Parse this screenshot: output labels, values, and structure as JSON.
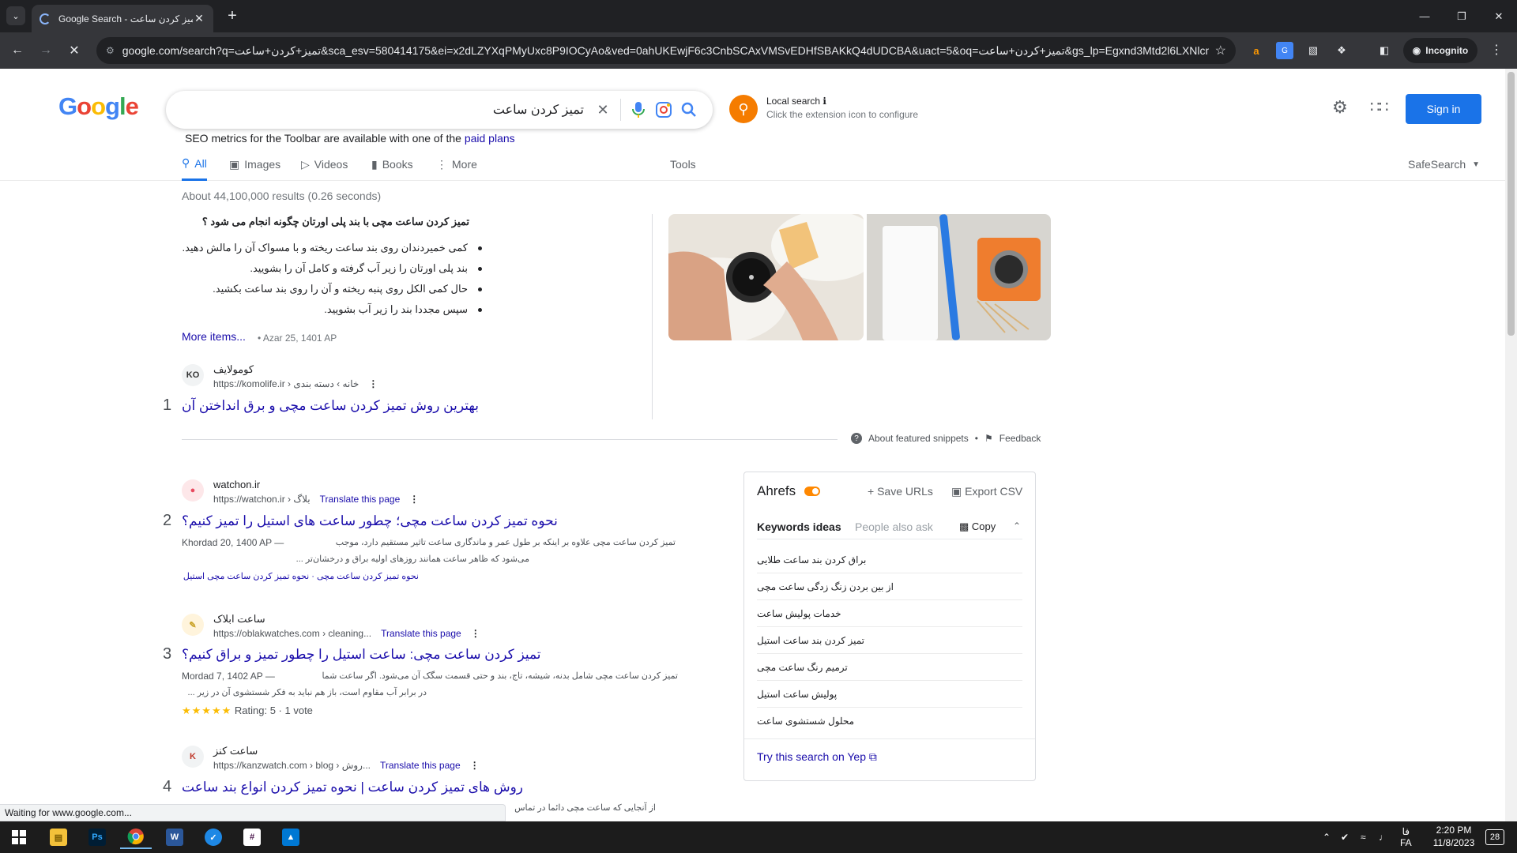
{
  "browser": {
    "tab_title": "Google Search - تمیز کردن ساعت",
    "tab_close": "✕",
    "new_tab": "+",
    "url": "google.com/search?q=تمیز+کردن+ساعت&sca_esv=580414175&ei=x2dLZYXqPMyUxc8P9IOCyAo&ved=0ahUKEwjF6c3CnbSCAxVMSvEDHfSBAKkQ4dUDCBA&uact=5&oq=تمیز+کردن+ساعت&gs_lp=Egxnd3Mtd2l6LXNlcnAi...",
    "incognito_label": "Incognito",
    "status_text": "Waiting for www.google.com..."
  },
  "google": {
    "logo": [
      "G",
      "o",
      "o",
      "g",
      "l",
      "e"
    ],
    "logo_colors": [
      "#4285f4",
      "#ea4335",
      "#fbbc05",
      "#4285f4",
      "#34a853",
      "#ea4335"
    ],
    "query": "تمیز کردن ساعت",
    "signin_label": "Sign in",
    "local_search_title": "Local search ℹ",
    "local_search_sub": "Click the extension icon to configure",
    "seo_note": "SEO metrics for the Toolbar are available with one of the",
    "seo_link": "paid plans",
    "tabs": {
      "all": "All",
      "images": "Images",
      "videos": "Videos",
      "books": "Books",
      "more": "More",
      "tools": "Tools"
    },
    "safesearch": "SafeSearch",
    "stats": "About 44,100,000 results (0.26 seconds)"
  },
  "snippet": {
    "question": "تمیز کردن ساعت مچی با بند پلی اورتان چگونه انجام می شود ؟",
    "items": [
      "کمی خمیردندان روی بند ساعت ریخته و با مسواک آن را مالش دهید.",
      "بند پلی اورتان را زیر آب گرفته و کامل آن را بشویید.",
      "حال کمی الکل روی پنبه ریخته و آن را روی بند ساعت بکشید.",
      "سپس مجددا بند را زیر آب بشویید."
    ],
    "more_items": "More items...",
    "date": "• Azar 25, 1401 AP",
    "source_name": "کومولایف",
    "source_url": "https://komolife.ir › خانه › دسته بندی",
    "source_fav": "KO",
    "title": "بهترین روش تمیز کردن ساعت مچی و برق انداختن آن",
    "num": "1",
    "about": "About featured snippets",
    "sep": "•",
    "feedback": "Feedback"
  },
  "results": [
    {
      "num": "2",
      "site": "watchon.ir",
      "url": "https://watchon.ir › بلاگ",
      "translate": "Translate this page",
      "title": "نحوه تمیز کردن ساعت مچی؛ چطور ساعت های استیل را تمیز کنیم؟",
      "meta": "Khordad 20, 1400 AP —",
      "line1": "تمیز کردن ساعت مچی علاوه بر اینکه بر طول عمر و ماندگاری ساعت تاثیر مستقیم دارد، موجب",
      "line2": "می‌شود که ظاهر ساعت همانند روزهای اولیه براق و درخشان‌تر ...",
      "sitelinks": "نحوه تمیز کردن ساعت مچی · نحوه تمیز کردن ساعت مچی استیل"
    },
    {
      "num": "3",
      "site": "ساعت ابلاک",
      "url": "https://oblakwatches.com › cleaning...",
      "translate": "Translate this page",
      "title": "تمیز کردن ساعت مچی: ساعت استیل را چطور تمیز و براق کنیم؟",
      "meta": "Mordad 7, 1402 AP —",
      "line1": "تمیز کردن ساعت مچی شامل بدنه، شیشه، تاج، بند و حتی قسمت سگک آن می‌شود. اگر ساعت شما",
      "line2": "در برابر آب مقاوم است، باز هم نباید به فکر شستشوی آن در زیر ...",
      "stars": "★★★★★",
      "rating": "Rating: 5 · 1 vote"
    },
    {
      "num": "4",
      "site": "ساعت کنز",
      "url": "https://kanzwatch.com › blog › روش...",
      "translate": "Translate this page",
      "title": "روش های تمیز کردن ساعت | نحوه تمیز کردن انواع بند ساعت",
      "line1": "از آنجایی که ساعت مچی دائما در تماس"
    }
  ],
  "ahrefs": {
    "title": "Ahrefs",
    "save_urls": "Save URLs",
    "export_csv": "Export CSV",
    "tab_keywords": "Keywords ideas",
    "tab_people": "People also ask",
    "copy": "Copy",
    "keywords": [
      "براق کردن بند ساعت طلایی",
      "از بین بردن زنگ زدگی ساعت مچی",
      "خدمات پولیش ساعت",
      "تمیز کردن بند ساعت استیل",
      "ترمیم رنگ ساعت مچی",
      "پولیش ساعت استیل",
      "محلول شستشوی ساعت"
    ],
    "try_yep": "Try this search on Yep ⧉"
  },
  "taskbar": {
    "clock_time": "2:20 PM",
    "clock_date": "11/8/2023",
    "lang1": "فا",
    "lang2": "FA",
    "notif_count": "28"
  }
}
